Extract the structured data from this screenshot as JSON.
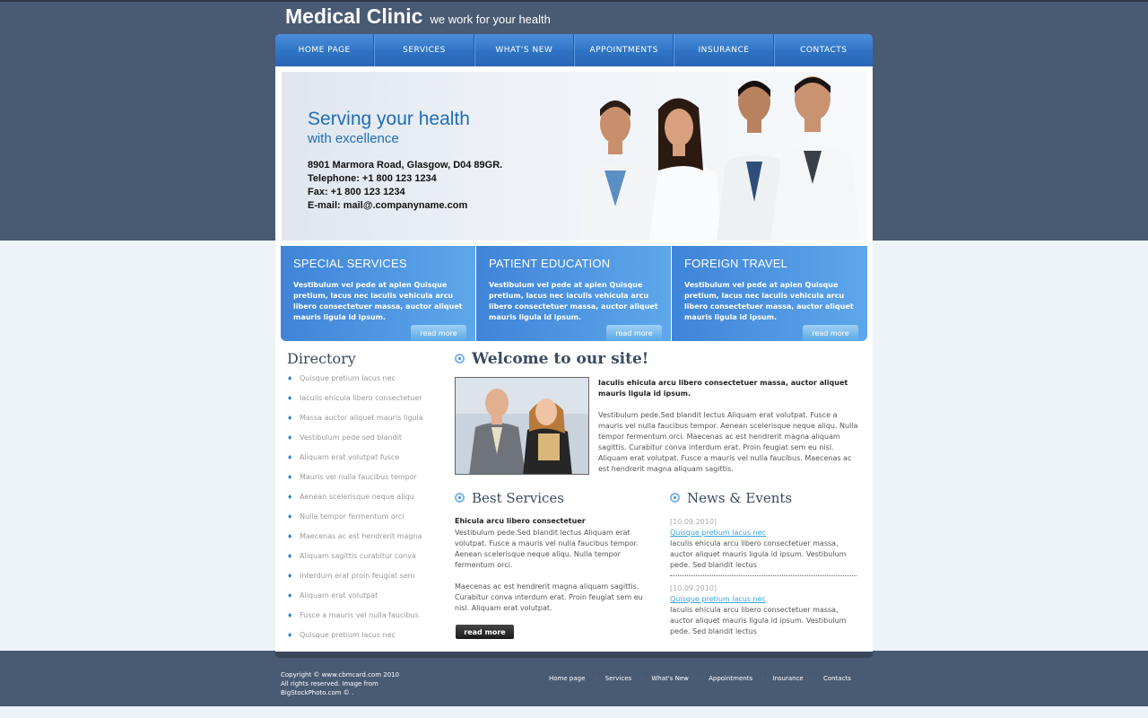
{
  "header": {
    "logo_main": "Medical Clinic",
    "logo_tagline": "we work for your health"
  },
  "nav": {
    "items": [
      "HOME PAGE",
      "SERVICES",
      "WHAT'S NEW",
      "APPOINTMENTS",
      "INSURANCE",
      "CONTACTS"
    ]
  },
  "hero": {
    "title": "Serving your health",
    "subtitle": "with excellence",
    "address": "8901 Marmora Road, Glasgow, D04 89GR.",
    "telephone": "Telephone: +1 800 123 1234",
    "fax": "Fax: +1 800 123 1234",
    "email": "E-mail: mail@.companyname.com"
  },
  "promos": [
    {
      "title": "SPECIAL SERVICES",
      "text": "Vestibulum vel pede at apien Quisque pretium, lacus nec iaculis vehicula arcu libero consectetuer massa, auctor aliquet mauris ligula id ipsum.",
      "button": "read more"
    },
    {
      "title": "PATIENT EDUCATION",
      "text": "Vestibulum vel pede at apien Quisque pretium, lacus nec iaculis vehicula arcu libero consectetuer massa, auctor aliquet mauris ligula id ipsum.",
      "button": "read more"
    },
    {
      "title": "FOREIGN TRAVEL",
      "text": "Vestibulum vel pede at apien Quisque pretium, lacus nec iaculis vehicula arcu libero consectetuer massa, auctor aliquet mauris ligula id ipsum.",
      "button": "read more"
    }
  ],
  "directory": {
    "title": "Directory",
    "items": [
      "Quisque pretium lacus nec",
      "Iaculis ehicula libero consectetuer",
      "Massa auctor aliquet mauris ligula",
      "Vestibulum pede sed blandit",
      "Aliquam erat volutpat fusce",
      "Mauris vel nulla faucibus tempor",
      "Aenean scelerisque neque aliqu",
      "Nulla tempor fermentum orci",
      "Maecenas ac est hendrerit magna",
      "Aliquam sagittis curabitur conva",
      "Interdum erat proin feugiat sem",
      "Aliquam erat volutpat",
      "Fusce a mauris vel nulla faucibus",
      "Quisque pretium lacus nec"
    ]
  },
  "welcome": {
    "title": "Welcome to our site!",
    "lead": "Iaculis ehicula arcu libero consectetuer massa, auctor aliquet mauris ligula id ipsum.",
    "body": "Vestibulum pede.Sed blandit lectus Aliquam erat volutpat. Fusce a mauris vel nulla faucibus tempor. Aenean scelerisque neque aliqu. Nulla tempor fermentum orci. Maecenas ac est hendrerit magna aliquam sagittis. Curabitur conva interdum erat. Proin feugiat sem eu nisl. Aliquam erat volutpat. Fusce a mauris vel nulla faucibus. Maecenas ac est hendrerit magna aliquam sagittis."
  },
  "best_services": {
    "title": "Best Services",
    "lead": "Ehicula arcu libero consectetuer",
    "body1": "Vestibulum pede.Sed blandit lectus Aliquam erat volutpat. Fusce a mauris vel nulla faucibus tempor. Aenean scelerisque neque aliqu. Nulla tempor fermentum orci.",
    "body2": "Maecenas ac est hendrerit magna aliquam sagittis. Curabitur conva interdum erat. Proin feugiat sem eu nisl. Aliquam erat volutpat.",
    "button": "read more"
  },
  "news": {
    "title": "News & Events",
    "items": [
      {
        "date": "[10.09.2010]",
        "link": "Quisque pretium lacus nec",
        "text": "Iaculis ehicula arcu libero consectetuer massa, auctor aliquet mauris ligula id ipsum. Vestibulum pede. Sed blandit lectus"
      },
      {
        "date": "[10.09.2010]",
        "link": "Quisque pretium lacus nec",
        "text": "Iaculis ehicula arcu libero consectetuer massa, auctor aliquet mauris ligula id ipsum. Vestibulum pede. Sed blandit lectus"
      }
    ]
  },
  "footer": {
    "copyright1": "Copyright © www.cbmcard.com 2010",
    "copyright2": "All rights reserved. Image from",
    "copyright3": "BigStockPhoto.com © .",
    "links": [
      "Home page",
      "Services",
      "What's New",
      "Appointments",
      "Insurance",
      "Contacts"
    ]
  },
  "colors": {
    "header_band": "#495a73",
    "nav_blue": "#2f73c4",
    "accent_blue": "#1f6db5",
    "promo_blue": "#4a93e0",
    "link_blue": "#39a2dd"
  }
}
